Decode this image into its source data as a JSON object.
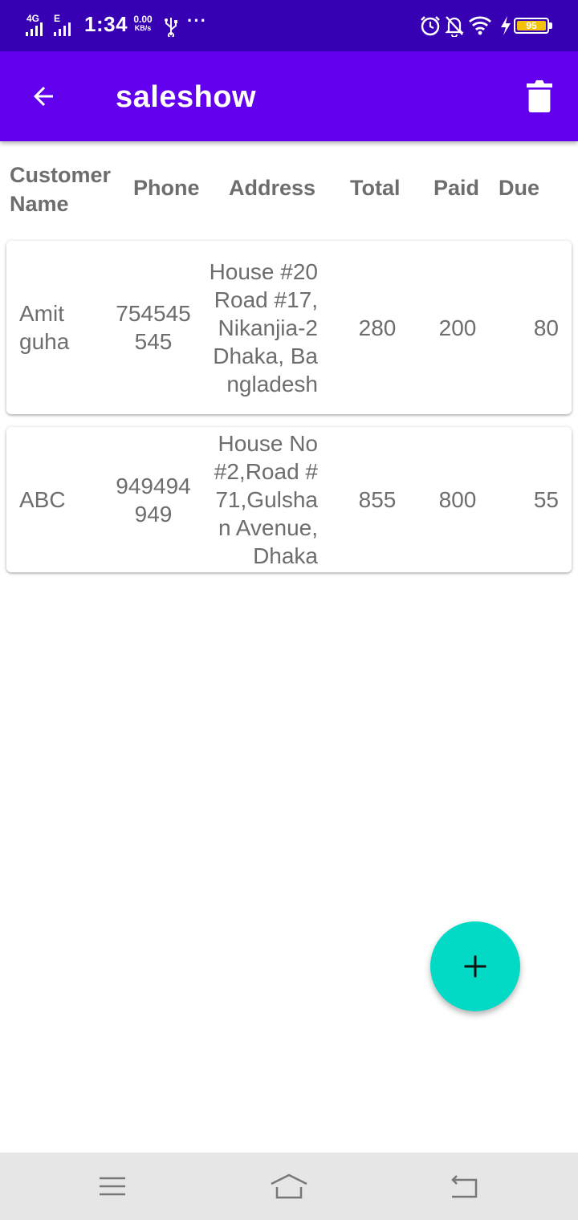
{
  "status_bar": {
    "network_label": "4G",
    "network_label_2": "E",
    "time": "1:34",
    "speed_value": "0.00",
    "speed_unit": "KB/s",
    "overflow": "···",
    "battery_level": "95",
    "background_color": "#3700b3"
  },
  "app_bar": {
    "title": "saleshow",
    "back_icon": "arrow-left-icon",
    "delete_icon": "trash-icon",
    "background_color": "#6200ee"
  },
  "table": {
    "headers": {
      "customer_name": "Customer Name",
      "phone": "Phone",
      "address": "Address",
      "total": "Total",
      "paid": "Paid",
      "due": "Due"
    },
    "rows": [
      {
        "customer_name": "Amit guha",
        "phone": "754545545",
        "address": "House #20 Road #17, Nikanjia-2 Dhaka, Bangladesh",
        "total": "280",
        "paid": "200",
        "due": "80"
      },
      {
        "customer_name": "ABC",
        "phone": "949494949",
        "address": "House No #2,Road #71,Gulshan Avenue,Dhaka",
        "total": "855",
        "paid": "800",
        "due": "55"
      }
    ]
  },
  "fab": {
    "icon": "plus-icon",
    "color": "#03dac5"
  },
  "nav_bar": {
    "menu_icon": "menu-icon",
    "home_icon": "home-icon",
    "back_icon": "back-icon"
  }
}
